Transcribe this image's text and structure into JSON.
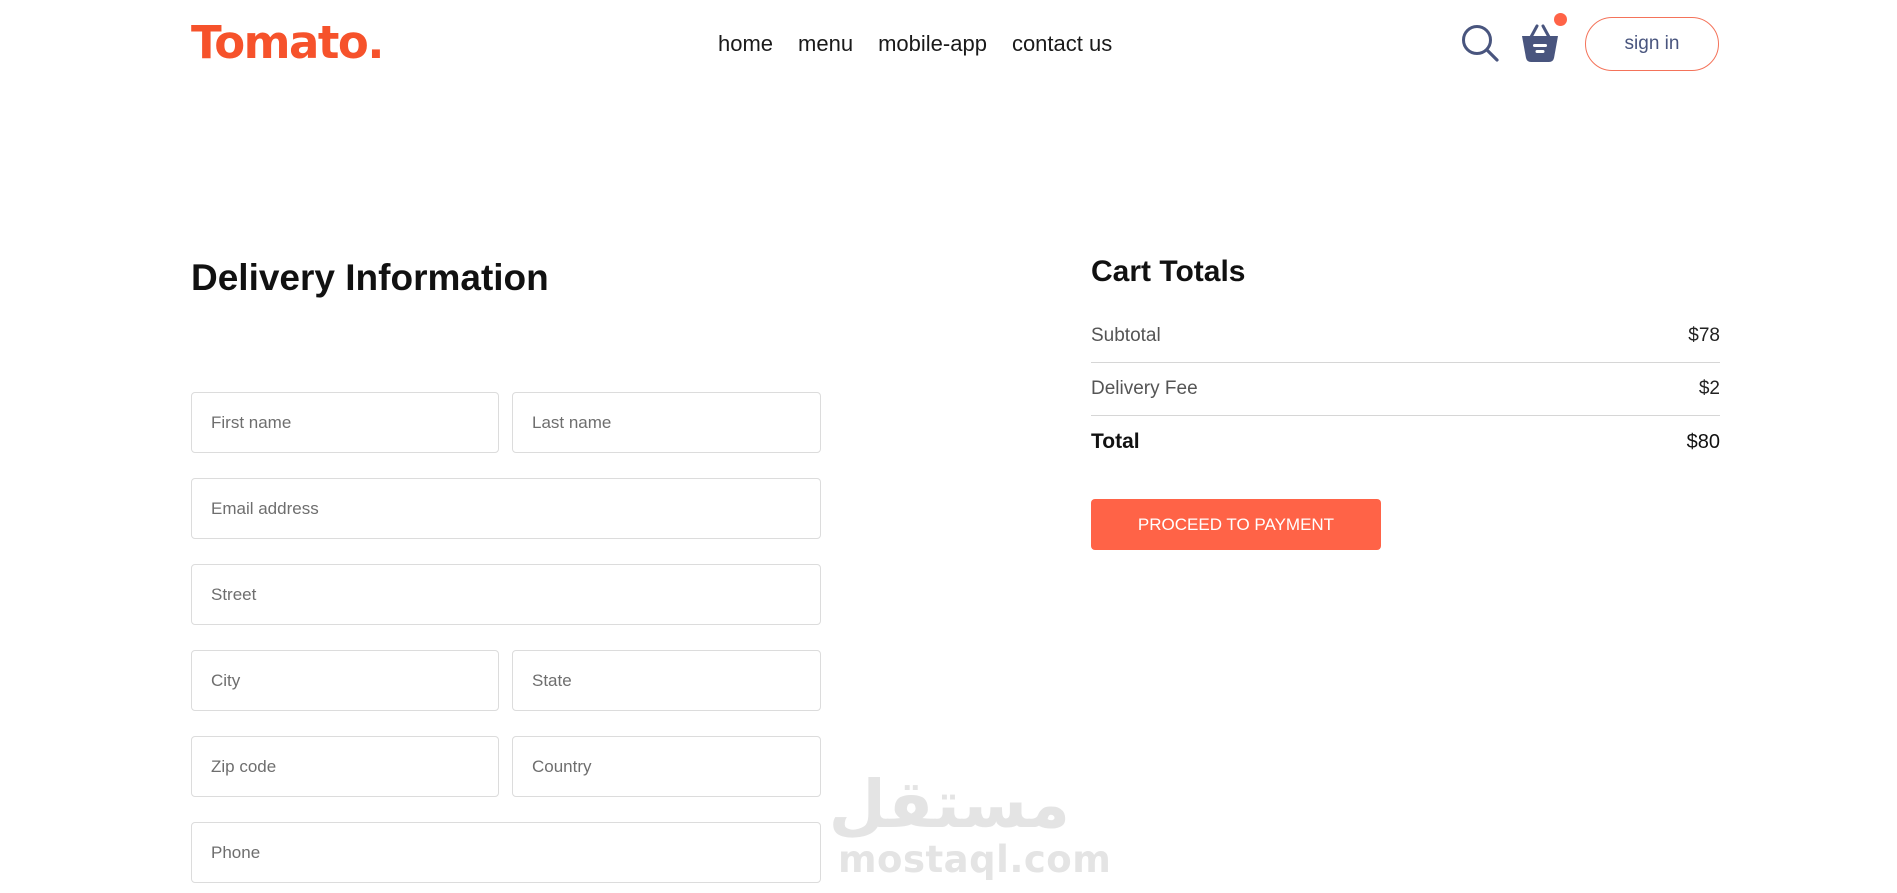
{
  "brand": {
    "logo": "Tomato.",
    "accent": "#ff6347"
  },
  "nav": {
    "items": [
      {
        "label": "home"
      },
      {
        "label": "menu"
      },
      {
        "label": "mobile-app"
      },
      {
        "label": "contact us"
      }
    ],
    "search_icon": "search-icon",
    "basket_icon": "basket-icon",
    "signin_label": "sign in"
  },
  "delivery": {
    "title": "Delivery Information",
    "fields": {
      "first_name": {
        "placeholder": "First name",
        "value": ""
      },
      "last_name": {
        "placeholder": "Last name",
        "value": ""
      },
      "email": {
        "placeholder": "Email address",
        "value": ""
      },
      "street": {
        "placeholder": "Street",
        "value": ""
      },
      "city": {
        "placeholder": "City",
        "value": ""
      },
      "state": {
        "placeholder": "State",
        "value": ""
      },
      "zip": {
        "placeholder": "Zip code",
        "value": ""
      },
      "country": {
        "placeholder": "Country",
        "value": ""
      },
      "phone": {
        "placeholder": "Phone",
        "value": ""
      }
    }
  },
  "cart": {
    "title": "Cart Totals",
    "subtotal": {
      "label": "Subtotal",
      "value": "$78"
    },
    "delivery_fee": {
      "label": "Delivery Fee",
      "value": "$2"
    },
    "total": {
      "label": "Total",
      "value": "$80"
    },
    "pay_label": "PROCEED TO PAYMENT"
  },
  "watermark": {
    "glyphs": "مستقل",
    "text": "mostaql.com"
  }
}
